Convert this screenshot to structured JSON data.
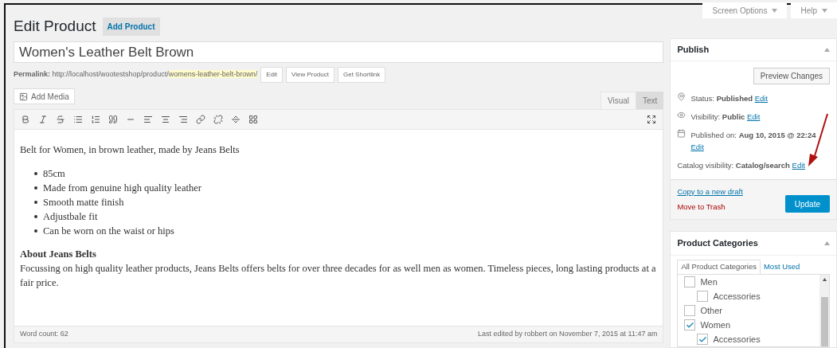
{
  "header": {
    "title": "Edit Product",
    "add_button": "Add Product"
  },
  "top_buttons": [
    {
      "label": "Screen Options"
    },
    {
      "label": "Help"
    }
  ],
  "title_field": {
    "value": "Women's Leather Belt Brown"
  },
  "permalink": {
    "label": "Permalink:",
    "base": "http://localhost/wootestshop/product/",
    "slug": "womens-leather-belt-brown/",
    "buttons": [
      "Edit",
      "View Product",
      "Get Shortlink"
    ]
  },
  "editor": {
    "add_media": "Add Media",
    "tabs": [
      {
        "label": "Visual",
        "selected": true
      },
      {
        "label": "Text",
        "selected": false
      }
    ],
    "content": [
      {
        "kind": "paragraph",
        "text": "Belt for Women, in brown leather, made by Jeans Belts"
      },
      {
        "kind": "list",
        "items": [
          "85cm",
          "Made from genuine high quality leather",
          "Smooth matte finish",
          "Adjustbale fit",
          "Can be worn on the waist or hips"
        ]
      },
      {
        "kind": "heading",
        "text": "About Jeans Belts"
      },
      {
        "kind": "paragraph",
        "text": "Focussing on high quality leather products, Jeans Belts offers belts for over three decades for as well men as women. Timeless pieces, long lasting products at a fair price."
      }
    ],
    "word_count": "Word count: 62",
    "last_edited": "Last edited by robbert on November 7, 2015 at 11:47 am"
  },
  "publish": {
    "title": "Publish",
    "preview_button": "Preview Changes",
    "rows": [
      {
        "kind": "status",
        "label": "Status:",
        "value": "Published",
        "link": "Edit"
      },
      {
        "kind": "visibility",
        "label": "Visibility:",
        "value": "Public",
        "link": "Edit"
      },
      {
        "kind": "date",
        "label": "Published on:",
        "value": "Aug 10, 2015 @ 22:24",
        "link": "Edit"
      },
      {
        "kind": "catalog",
        "label": "Catalog visibility:",
        "value": "Catalog/search",
        "link": "Edit"
      }
    ],
    "copy_link": "Copy to a new draft",
    "trash_link": "Move to Trash",
    "update_button": "Update"
  },
  "categories": {
    "title": "Product Categories",
    "tabs": [
      {
        "label": "All Product Categories",
        "selected": true
      },
      {
        "label": "Most Used",
        "selected": false
      }
    ],
    "items": [
      {
        "label": "Men",
        "checked": false,
        "children": [
          {
            "label": "Accessories",
            "checked": false
          }
        ]
      },
      {
        "label": "Other",
        "checked": false
      },
      {
        "label": "Women",
        "checked": true,
        "children": [
          {
            "label": "Accessories",
            "checked": true
          }
        ]
      }
    ]
  }
}
